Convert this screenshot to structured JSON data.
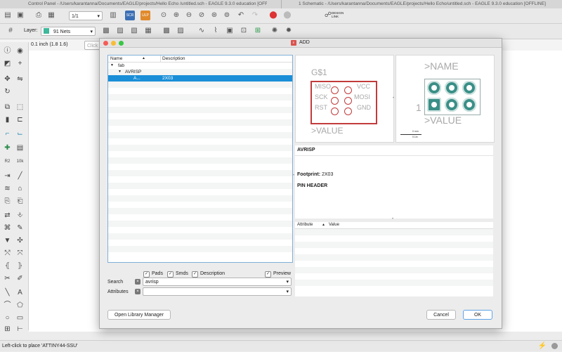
{
  "titlebar": {
    "tab1": "Control Panel - /Users/karantanna/Documents/EAGLE/projects/Hello Echo /untitled.sch - EAGLE 9.3.0 education [OFFLINE]",
    "tab2": "1 Schematic - /Users/karantanna/Documents/EAGLE/projects/Hello Echo/untitled.sch - EAGLE 9.3.0 education [OFFLINE]"
  },
  "toolbar": {
    "sheet_value": "1/1",
    "design_link": "DESIGN LINK",
    "layer_label": "Layer:",
    "layer_value": "91 Nets",
    "layer_color": "#3fb89c"
  },
  "command": {
    "coords": "0.1 inch (1.8 1.6)",
    "placeholder": "Click"
  },
  "status": {
    "text": "Left-click to place 'ATTINY44-SSU'"
  },
  "dialog": {
    "title": "ADD",
    "tree": {
      "col_name": "Name",
      "col_desc": "Description",
      "rows": [
        {
          "name": "fab",
          "desc": ""
        },
        {
          "name": "AVRISP",
          "desc": ""
        },
        {
          "name": "A...",
          "desc": "2X03"
        }
      ]
    },
    "symbol": {
      "name": ">NAME",
      "gate": "G$1",
      "value": ">VALUE",
      "pins_left": [
        "MISO",
        "SCK",
        "RST"
      ],
      "pins_right": [
        "VCC",
        "MOSI",
        "GND"
      ],
      "color": "#c23b3b"
    },
    "package": {
      "name": ">NAME",
      "value": ">VALUE",
      "pin1": "1",
      "pad_color": "#3a8f87",
      "scale_top": "0 mm",
      "scale_bottom": "0.1in"
    },
    "info": {
      "title": "AVRISP",
      "footprint_label": "Footprint:",
      "footprint_value": "2X03",
      "description": "PIN HEADER"
    },
    "attributes": {
      "col_attr": "Attribute",
      "col_value": "Value"
    },
    "filters": {
      "pads": "Pads",
      "smds": "Smds",
      "description": "Description",
      "preview": "Preview"
    },
    "search": {
      "label": "Search",
      "value": "avrisp"
    },
    "attributes_field": {
      "label": "Attributes",
      "value": ""
    },
    "buttons": {
      "library_manager": "Open Library Manager",
      "cancel": "Cancel",
      "ok": "OK"
    }
  }
}
